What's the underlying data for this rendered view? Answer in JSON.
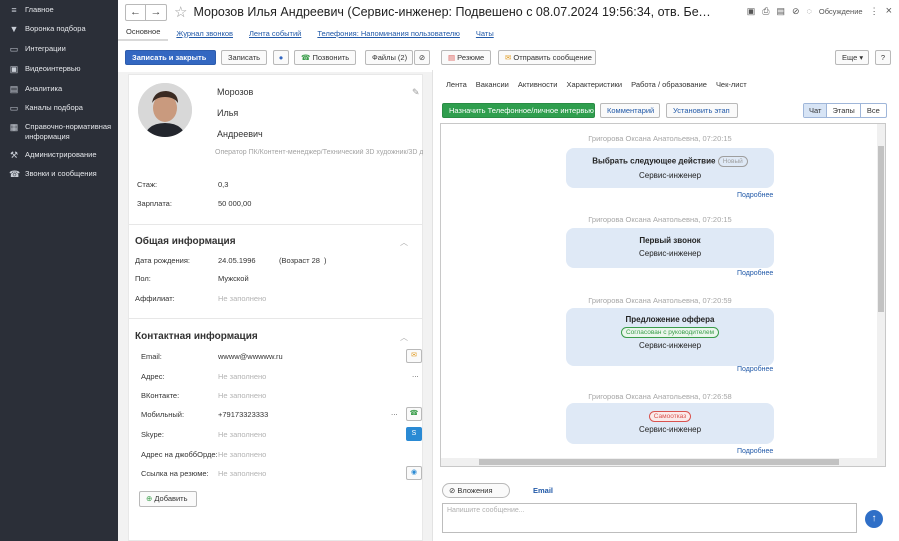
{
  "sidebar": {
    "items": [
      {
        "label": "Главное",
        "icon": "menu-icon"
      },
      {
        "label": "Воронка подбора",
        "icon": "funnel-icon"
      },
      {
        "label": "Интеграции",
        "icon": "folder-icon"
      },
      {
        "label": "Видеоинтервью",
        "icon": "video-icon"
      },
      {
        "label": "Аналитика",
        "icon": "chart-icon"
      },
      {
        "label": "Каналы подбора",
        "icon": "folder-icon"
      },
      {
        "label": "Справочно-нормативная информация",
        "icon": "grid-icon"
      },
      {
        "label": "Администрирование",
        "icon": "wrench-icon"
      },
      {
        "label": "Звонки и сообщения",
        "icon": "phone-icon"
      }
    ]
  },
  "header": {
    "title": "Морозов Илья Андреевич (Сервис-инженер: Подвешено с 08.07.2024 19:56:34, отв. Белов Александр Г...",
    "discussion_label": "Обсуждение",
    "more_icon": "⋮",
    "close_icon": "×"
  },
  "tabs": [
    {
      "label": "Основное",
      "active": true
    },
    {
      "label": "Журнал звонков"
    },
    {
      "label": "Лента событий"
    },
    {
      "label": "Телефония: Напоминания пользователю"
    },
    {
      "label": "Чаты"
    }
  ],
  "toolbar": {
    "save_close": "Записать и закрыть",
    "save": "Записать",
    "call": "Позвонить",
    "files": "Файлы (2)",
    "resume": "Резюме",
    "send_message": "Отправить сообщение",
    "more": "Еще",
    "help": "?"
  },
  "profile": {
    "last_name": "Морозов",
    "first_name": "Илья",
    "middle_name": "Андреевич",
    "positions": "Оператор ПК/Контент-менеджер/Технический 3D художник/3D д",
    "experience_label": "Стаж:",
    "experience_value": "0,3",
    "salary_label": "Зарплата:",
    "salary_value": "50 000,00"
  },
  "general_info": {
    "title": "Общая информация",
    "birth_label": "Дата рождения:",
    "birth_value": "24.05.1996",
    "age_label": "(Возраст 28",
    "age_close": ")",
    "gender_label": "Пол:",
    "gender_value": "Мужской",
    "affiliate_label": "Аффилиат:",
    "affiliate_value": "Не заполнено"
  },
  "contact_info": {
    "title": "Контактная информация",
    "rows": [
      {
        "label": "Email:",
        "value": "wwww@wwwww.ru",
        "empty": false
      },
      {
        "label": "Адрес:",
        "value": "Не заполнено",
        "empty": true
      },
      {
        "label": "ВКонтакте:",
        "value": "Не заполнено",
        "empty": true
      },
      {
        "label": "Мобильный:",
        "value": "+79173323333",
        "empty": false
      },
      {
        "label": "Skype:",
        "value": "Не заполнено",
        "empty": true
      },
      {
        "label": "Адрес на джоббОрде:",
        "value": "Не заполнено",
        "empty": true
      },
      {
        "label": "Ссылка на резюме:",
        "value": "Не заполнено",
        "empty": true
      }
    ],
    "add_button": "Добавить",
    "dots": "...",
    "dots_mobile": "..."
  },
  "right_tabs": [
    "Лента",
    "Вакансии",
    "Активности",
    "Характеристики",
    "Работа / образование",
    "Чек-лист"
  ],
  "actions": {
    "assign": "Назначить Телефонное/личное интервью",
    "comment": "Комментарий",
    "stage": "Установить этап",
    "filter": [
      "Чат",
      "Этапы",
      "Все"
    ]
  },
  "feed": [
    {
      "author": "Григорова Оксана Анатольевна, 07:20:15",
      "title": "Выбрать следующее действие",
      "badge": "Новый",
      "badge_color": "#9e9e9e",
      "subtitle": "Сервис-инженер",
      "more": "Подробнее"
    },
    {
      "author": "Григорова Оксана Анатольевна, 07:20:15",
      "title": "Первый звонок",
      "subtitle": "Сервис-инженер",
      "more": "Подробнее"
    },
    {
      "author": "Григорова Оксана Анатольевна, 07:20:59",
      "title": "Предложение оффера",
      "badge": "Согласован с руководителем",
      "badge_color": "#3a9d4a",
      "subtitle": "Сервис-инженер",
      "more": "Подробнее"
    },
    {
      "author": "Григорова Оксана Анатольевна, 07:26:58",
      "badge": "Самоотказ",
      "badge_color": "#d9534f",
      "subtitle": "Сервис-инженер",
      "more": "Подробнее"
    }
  ],
  "bottom": {
    "attachments": "Вложения",
    "email": "Email",
    "placeholder": "Напишите сообщение..."
  },
  "colors": {
    "sidebar_bg": "#2b2f38",
    "primary": "#3367c1",
    "assign_green": "#2f9e4e",
    "bubble": "#dfe9f6",
    "link": "#2159a8"
  }
}
